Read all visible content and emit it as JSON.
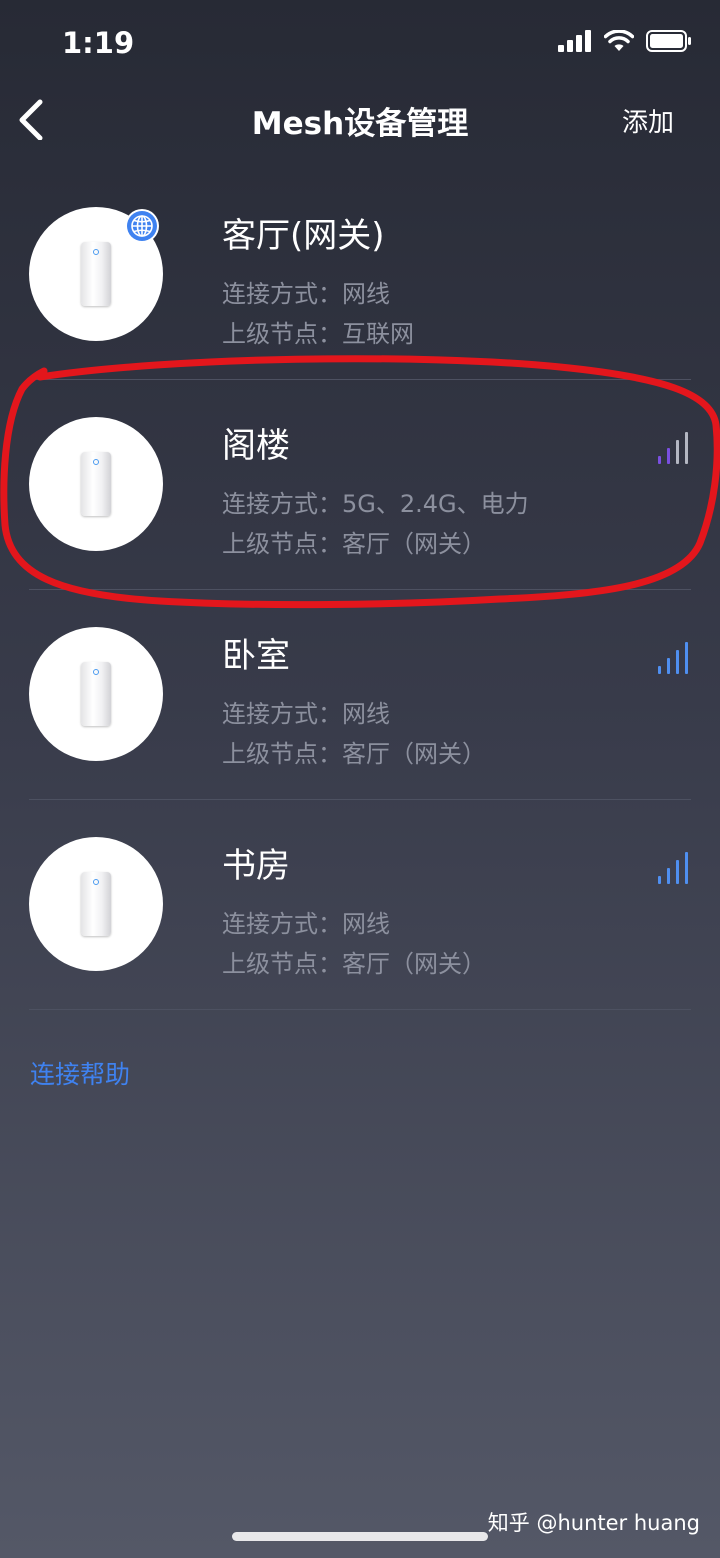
{
  "status_bar": {
    "time": "1:19",
    "icons": [
      "cellular-signal-icon",
      "wifi-icon",
      "battery-icon"
    ]
  },
  "nav": {
    "title": "Mesh设备管理",
    "add_label": "添加",
    "back_icon": "chevron-left-icon"
  },
  "devices": [
    {
      "name": "客厅(网关)",
      "connection": "连接方式：网线",
      "parent": "上级节点：互联网",
      "is_gateway": true,
      "signal_bars": null
    },
    {
      "name": "阁楼",
      "connection": "连接方式：5G、2.4G、电力",
      "parent": "上级节点：客厅（网关）",
      "is_gateway": false,
      "signal_bars": 2,
      "signal_color": "#7a4fe0"
    },
    {
      "name": "卧室",
      "connection": "连接方式：网线",
      "parent": "上级节点：客厅（网关）",
      "is_gateway": false,
      "signal_bars": 4,
      "signal_color": "#4f8ff0"
    },
    {
      "name": "书房",
      "connection": "连接方式：网线",
      "parent": "上级节点：客厅（网关）",
      "is_gateway": false,
      "signal_bars": 4,
      "signal_color": "#4f8ff0"
    }
  ],
  "help_link": "连接帮助",
  "watermark": "知乎 @hunter huang",
  "colors": {
    "accent": "#3f82f0",
    "annotation": "#e3161c",
    "secondary_text": "#8c909e"
  }
}
